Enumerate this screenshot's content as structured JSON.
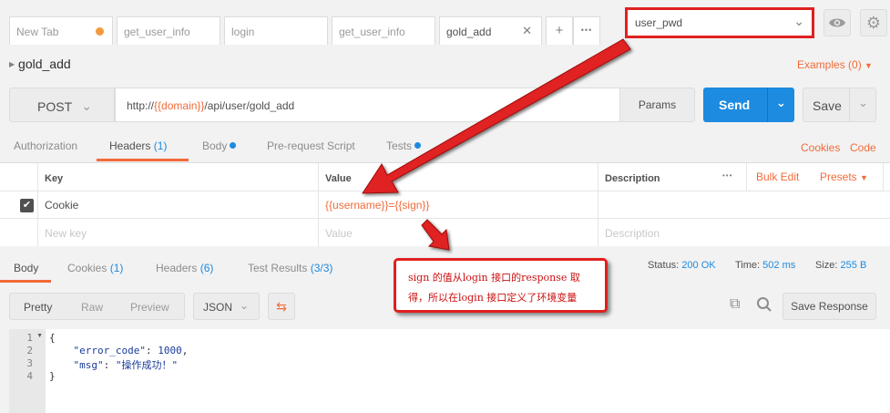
{
  "tabs": [
    {
      "label": "New Tab",
      "unsaved": true
    },
    {
      "label": "get_user_info"
    },
    {
      "label": "login"
    },
    {
      "label": "get_user_info"
    },
    {
      "label": "gold_add",
      "active": true
    }
  ],
  "tab_actions": {
    "add": "+",
    "more": "•••"
  },
  "environment": {
    "selected": "user_pwd"
  },
  "request": {
    "name": "gold_add",
    "examples_label": "Examples (0)",
    "method": "POST",
    "url_prefix": "http://",
    "url_var": "{{domain}}",
    "url_suffix": "/api/user/gold_add",
    "params_label": "Params",
    "send_label": "Send",
    "save_label": "Save"
  },
  "request_tabs": {
    "authorization": "Authorization",
    "headers": "Headers",
    "headers_count": "(1)",
    "body": "Body",
    "prerequest": "Pre-request Script",
    "tests": "Tests",
    "cookies_link": "Cookies",
    "code_link": "Code"
  },
  "headers_table": {
    "col_key": "Key",
    "col_value": "Value",
    "col_description": "Description",
    "more": "•••",
    "bulk_edit": "Bulk Edit",
    "presets": "Presets",
    "rows": [
      {
        "key": "Cookie",
        "value": "{{username}}={{sign}}",
        "checked": true
      }
    ],
    "new_key_placeholder": "New key",
    "value_placeholder": "Value",
    "description_placeholder": "Description"
  },
  "response_tabs": {
    "body": "Body",
    "cookies": "Cookies",
    "cookies_count": "(1)",
    "headers": "Headers",
    "headers_count": "(6)",
    "test_results": "Test Results",
    "test_results_count": "(3/3)"
  },
  "response_status": {
    "status_label": "Status:",
    "status_value": "200 OK",
    "time_label": "Time:",
    "time_value": "502 ms",
    "size_label": "Size:",
    "size_value": "255 B"
  },
  "response_view": {
    "pretty": "Pretty",
    "raw": "Raw",
    "preview": "Preview",
    "format": "JSON",
    "save_response": "Save Response"
  },
  "response_body": {
    "line_numbers": [
      "1",
      "2",
      "3",
      "4"
    ],
    "line1": "{",
    "error_code_key": "\"error_code\"",
    "error_code_value": "1000",
    "msg_key": "\"msg\"",
    "msg_value": "\"操作成功！\"",
    "line4": "}"
  },
  "annotation": {
    "line1": "sign 的值从login 接口的response 取",
    "line2": "得，所以在login 接口定义了环境变量"
  },
  "colors": {
    "accent": "#f26b3a",
    "primary": "#1c8be0",
    "annotation_red": "#e02020"
  }
}
